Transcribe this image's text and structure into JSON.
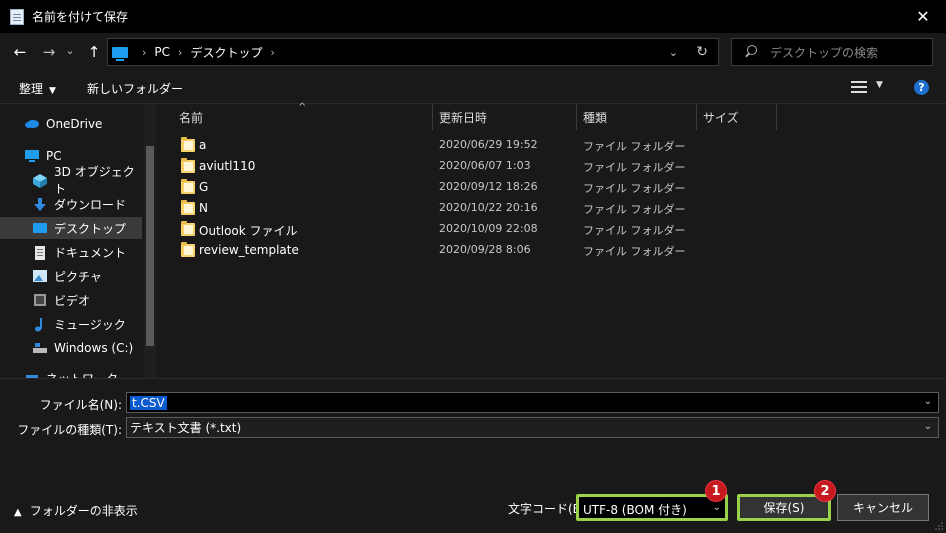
{
  "window": {
    "title": "名前を付けて保存",
    "close_glyph": "✕"
  },
  "nav": {
    "back_glyph": "←",
    "forward_glyph": "→",
    "recent_glyph": "⌄",
    "up_glyph": "↑",
    "breadcrumbs": [
      "PC",
      "デスクトップ"
    ],
    "crumb_sep": "›",
    "dropdown_glyph": "⌄",
    "refresh_glyph": "↻",
    "search_placeholder": "デスクトップの検索"
  },
  "toolbar": {
    "organize_label": "整理",
    "organize_caret": "▼",
    "new_folder_label": "新しいフォルダー",
    "view_caret": "▼",
    "help_glyph": "?"
  },
  "sidebar": {
    "items": [
      {
        "label": "OneDrive",
        "icon": "cloud-icon"
      },
      {
        "label": "PC",
        "icon": "computer-icon"
      },
      {
        "label": "3D オブジェクト",
        "icon": "cube-icon"
      },
      {
        "label": "ダウンロード",
        "icon": "download-icon"
      },
      {
        "label": "デスクトップ",
        "icon": "desktop-icon"
      },
      {
        "label": "ドキュメント",
        "icon": "document-icon"
      },
      {
        "label": "ピクチャ",
        "icon": "picture-icon"
      },
      {
        "label": "ビデオ",
        "icon": "video-icon"
      },
      {
        "label": "ミュージック",
        "icon": "music-icon"
      },
      {
        "label": "Windows (C:)",
        "icon": "drive-icon"
      },
      {
        "label": "ネットワーク",
        "icon": "network-icon"
      }
    ]
  },
  "filelist": {
    "columns": {
      "name": "名前",
      "modified": "更新日時",
      "type": "種類",
      "size": "サイズ"
    },
    "sort_glyph": "^",
    "rows": [
      {
        "name": "a",
        "modified": "2020/06/29 19:52",
        "type": "ファイル フォルダー"
      },
      {
        "name": "aviutl110",
        "modified": "2020/06/07 1:03",
        "type": "ファイル フォルダー"
      },
      {
        "name": "G",
        "modified": "2020/09/12 18:26",
        "type": "ファイル フォルダー"
      },
      {
        "name": "N",
        "modified": "2020/10/22 20:16",
        "type": "ファイル フォルダー"
      },
      {
        "name": "Outlook ファイル",
        "modified": "2020/10/09 22:08",
        "type": "ファイル フォルダー"
      },
      {
        "name": "review_template",
        "modified": "2020/09/28 8:06",
        "type": "ファイル フォルダー"
      }
    ]
  },
  "form": {
    "filename_label": "ファイル名(N):",
    "filename_value": "t.CSV",
    "filetype_label": "ファイルの種類(T):",
    "filetype_value": "テキスト文書 (*.txt)",
    "combo_chevron": "⌄",
    "hide_folders_caret": "▲",
    "hide_folders_label": "フォルダーの非表示",
    "encoding_label": "文字コード(E):",
    "encoding_value": "UTF-8 (BOM 付き)",
    "save_label": "保存(S)",
    "cancel_label": "キャンセル"
  },
  "annotations": {
    "badge1": "1",
    "badge2": "2"
  },
  "colors": {
    "highlight": "#9bd14a",
    "badge": "#c8191e",
    "selection": "#0a5ad0"
  }
}
